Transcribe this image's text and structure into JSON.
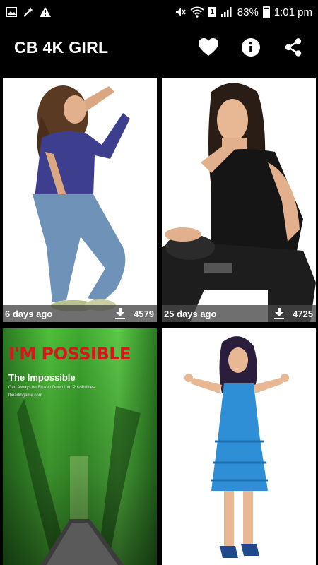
{
  "status_bar": {
    "battery": "83%",
    "time": "1:01 pm",
    "sim_badge": "1",
    "icons": [
      "image-icon",
      "wand-icon",
      "warning-icon",
      "mute-icon",
      "wifi-icon",
      "signal-icon",
      "battery-icon"
    ]
  },
  "app_bar": {
    "title": "CB 4K GIRL",
    "actions": [
      "heart-icon",
      "info-icon",
      "share-icon"
    ]
  },
  "wallpapers": [
    {
      "age": "6 days ago",
      "downloads": "4579"
    },
    {
      "age": "25 days ago",
      "downloads": "4725"
    },
    {
      "age": "",
      "downloads": "",
      "title": "I'M POSSIBLE",
      "subtitle": "The Impossible",
      "line1": "Can Always be Broken Down Into Possibilities",
      "line2": "theadingame.com"
    },
    {
      "age": "",
      "downloads": ""
    }
  ],
  "colors": {
    "background": "#000000",
    "card_bg": "#ffffff",
    "caption_bg": "#464646",
    "accent_red": "#d8161c"
  }
}
